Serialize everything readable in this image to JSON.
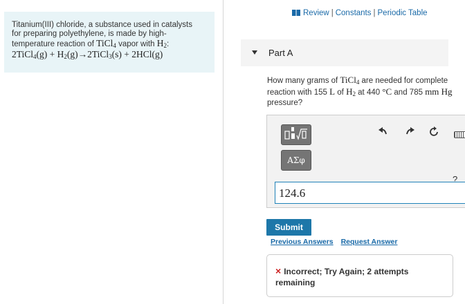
{
  "intro": {
    "text_line1": "Titanium(III) chloride, a substance used in catalysts",
    "text_line2": "for preparing polyethylene, is made by high-",
    "text_line3_pre": "temperature reaction of ",
    "ticl4": "TiCl",
    "ticl4_sub": "4",
    "text_line3_mid": " vapor with ",
    "h2": "H",
    "h2_sub": "2",
    "text_line3_post": ":",
    "reaction": {
      "r1_coef": "2TiCl",
      "r1_sub": "4",
      "r1_state": "(g) + H",
      "r2_sub": "2",
      "r2_state": "(g)→2TiCl",
      "p1_sub": "3",
      "p1_state": "(s) + 2HCl(g)"
    }
  },
  "toplinks": {
    "review": "Review",
    "sep": "|",
    "constants": "Constants",
    "periodic": "Periodic Table"
  },
  "part": {
    "label": "Part A"
  },
  "question": {
    "pre": "How many grams of ",
    "ticl": "TiCl",
    "ticl_sub": "4",
    "mid1": " are needed for complete reaction with 155 ",
    "unit_L": "L",
    "mid2": " of ",
    "h": "H",
    "h_sub": "2",
    "mid3": " at 440 ",
    "deg": "°C",
    "mid4": " and 785 ",
    "mmhg": "mm Hg",
    "post": " pressure?"
  },
  "toolbar": {
    "greek_label": "ΑΣφ",
    "undo_icon": "undo-icon",
    "redo_icon": "redo-icon",
    "reset_icon": "reset-icon",
    "help_label": "?"
  },
  "answer": {
    "value": "124.6"
  },
  "actions": {
    "submit": "Submit",
    "previous": "Previous Answers",
    "request": "Request Answer"
  },
  "feedback": {
    "icon": "×",
    "message": "Incorrect; Try Again; 2 attempts remaining"
  },
  "colors": {
    "accent": "#1d77a9",
    "intro_bg": "#e8f4f7",
    "error": "#cc2222"
  }
}
